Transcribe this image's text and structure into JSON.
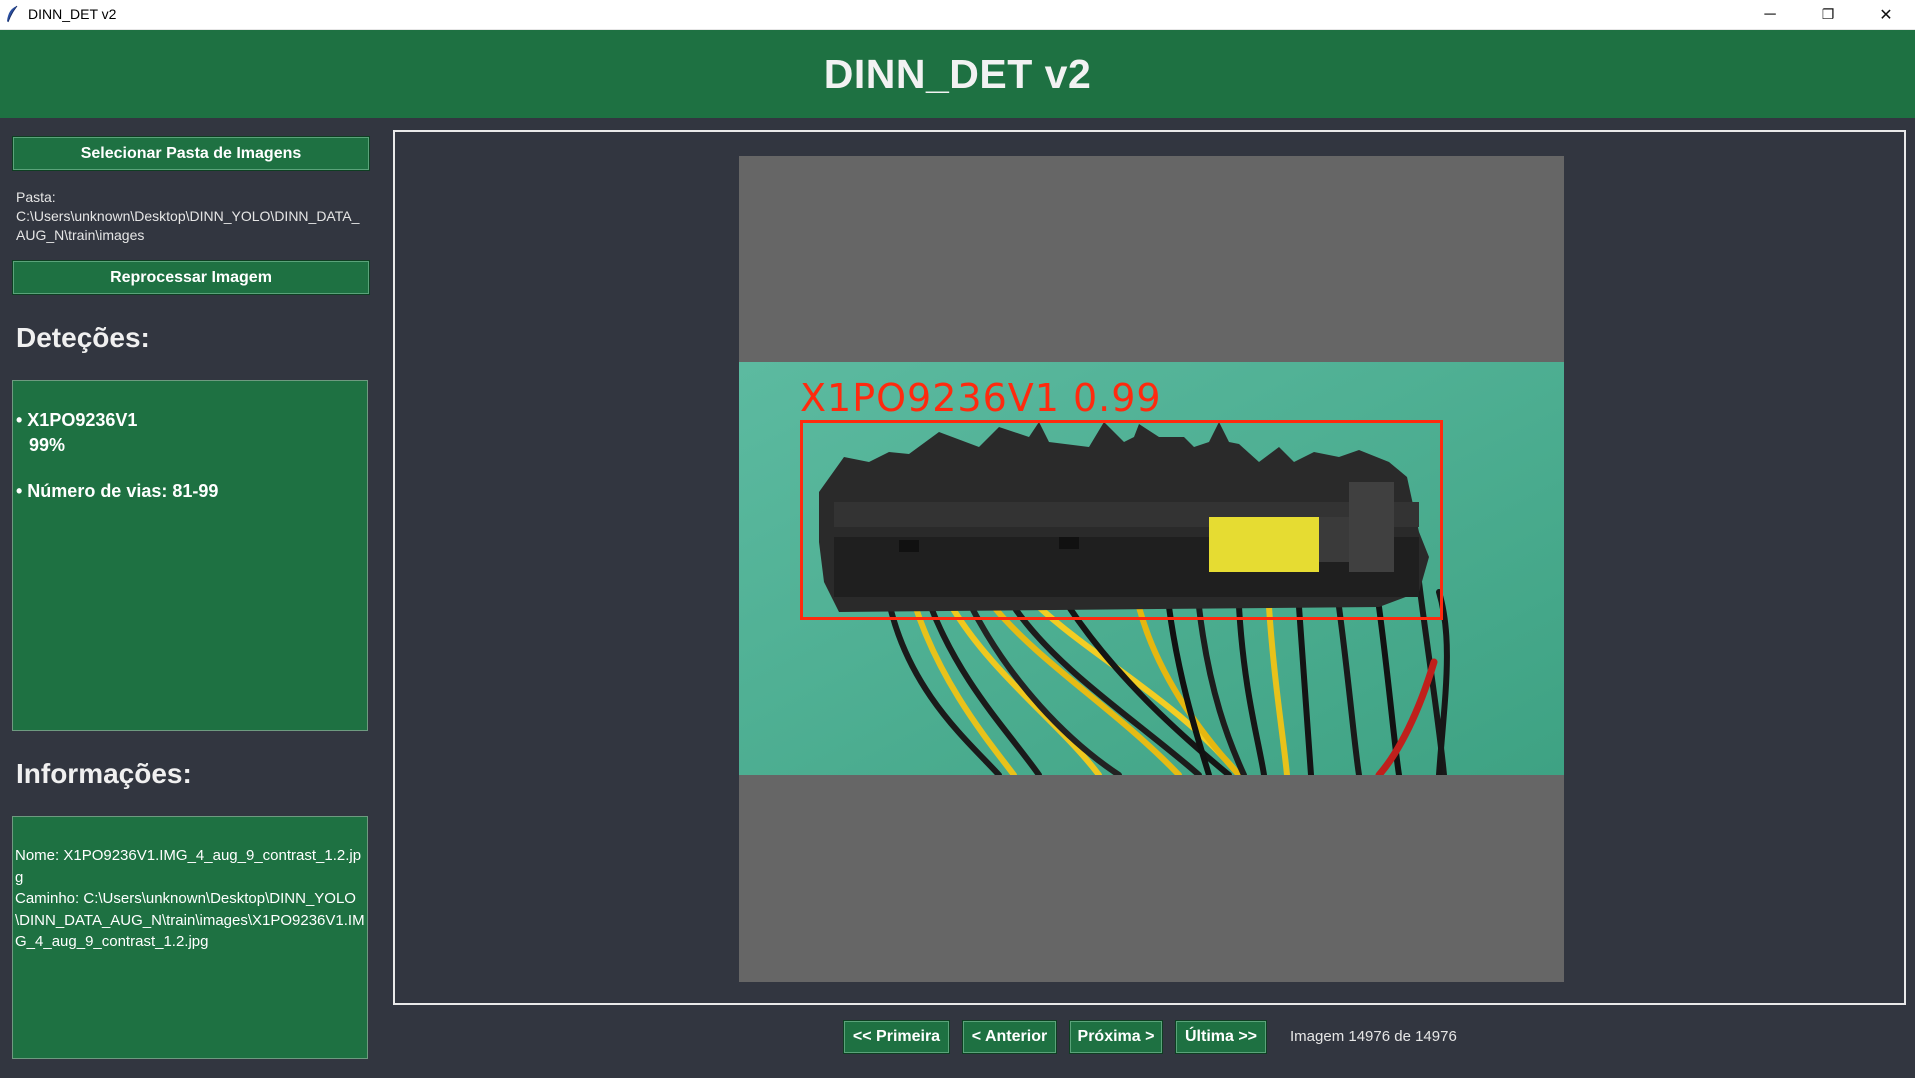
{
  "window": {
    "title": "DINN_DET v2",
    "controls": {
      "minimize": "─",
      "restore": "❐",
      "close": "✕"
    }
  },
  "header": {
    "title": "DINN_DET v2"
  },
  "sidebar": {
    "select_folder_button": "Selecionar Pasta de Imagens",
    "folder_label": "Pasta:",
    "folder_path": "C:\\Users\\unknown\\Desktop\\DINN_YOLO\\DINN_DATA_AUG_N\\train\\images",
    "reprocess_button": "Reprocessar Imagem",
    "detections_heading": "Deteções:",
    "detections": {
      "class_name": "• X1PO9236V1",
      "confidence": "99%",
      "ways": "• Número de vias: 81-99"
    },
    "info_heading": "Informações:",
    "info": {
      "name": "Nome: X1PO9236V1.IMG_4_aug_9_contrast_1.2.jpg",
      "path": "Caminho: C:\\Users\\unknown\\Desktop\\DINN_YOLO\\DINN_DATA_AUG_N\\train\\images\\X1PO9236V1.IMG_4_aug_9_contrast_1.2.jpg"
    }
  },
  "viewer": {
    "overlay_label": "X1PO9236V1  0.99",
    "colors": {
      "box": "#ff2a0e",
      "background": "#4fb296",
      "canvas": "#666666"
    }
  },
  "navigation": {
    "first": "<< Primeira",
    "previous": "< Anterior",
    "next": "Próxima >",
    "last": "Última >>",
    "counter": "Imagem 14976 de 14976"
  },
  "theme": {
    "accent": "#1e7142",
    "background": "#323640"
  }
}
